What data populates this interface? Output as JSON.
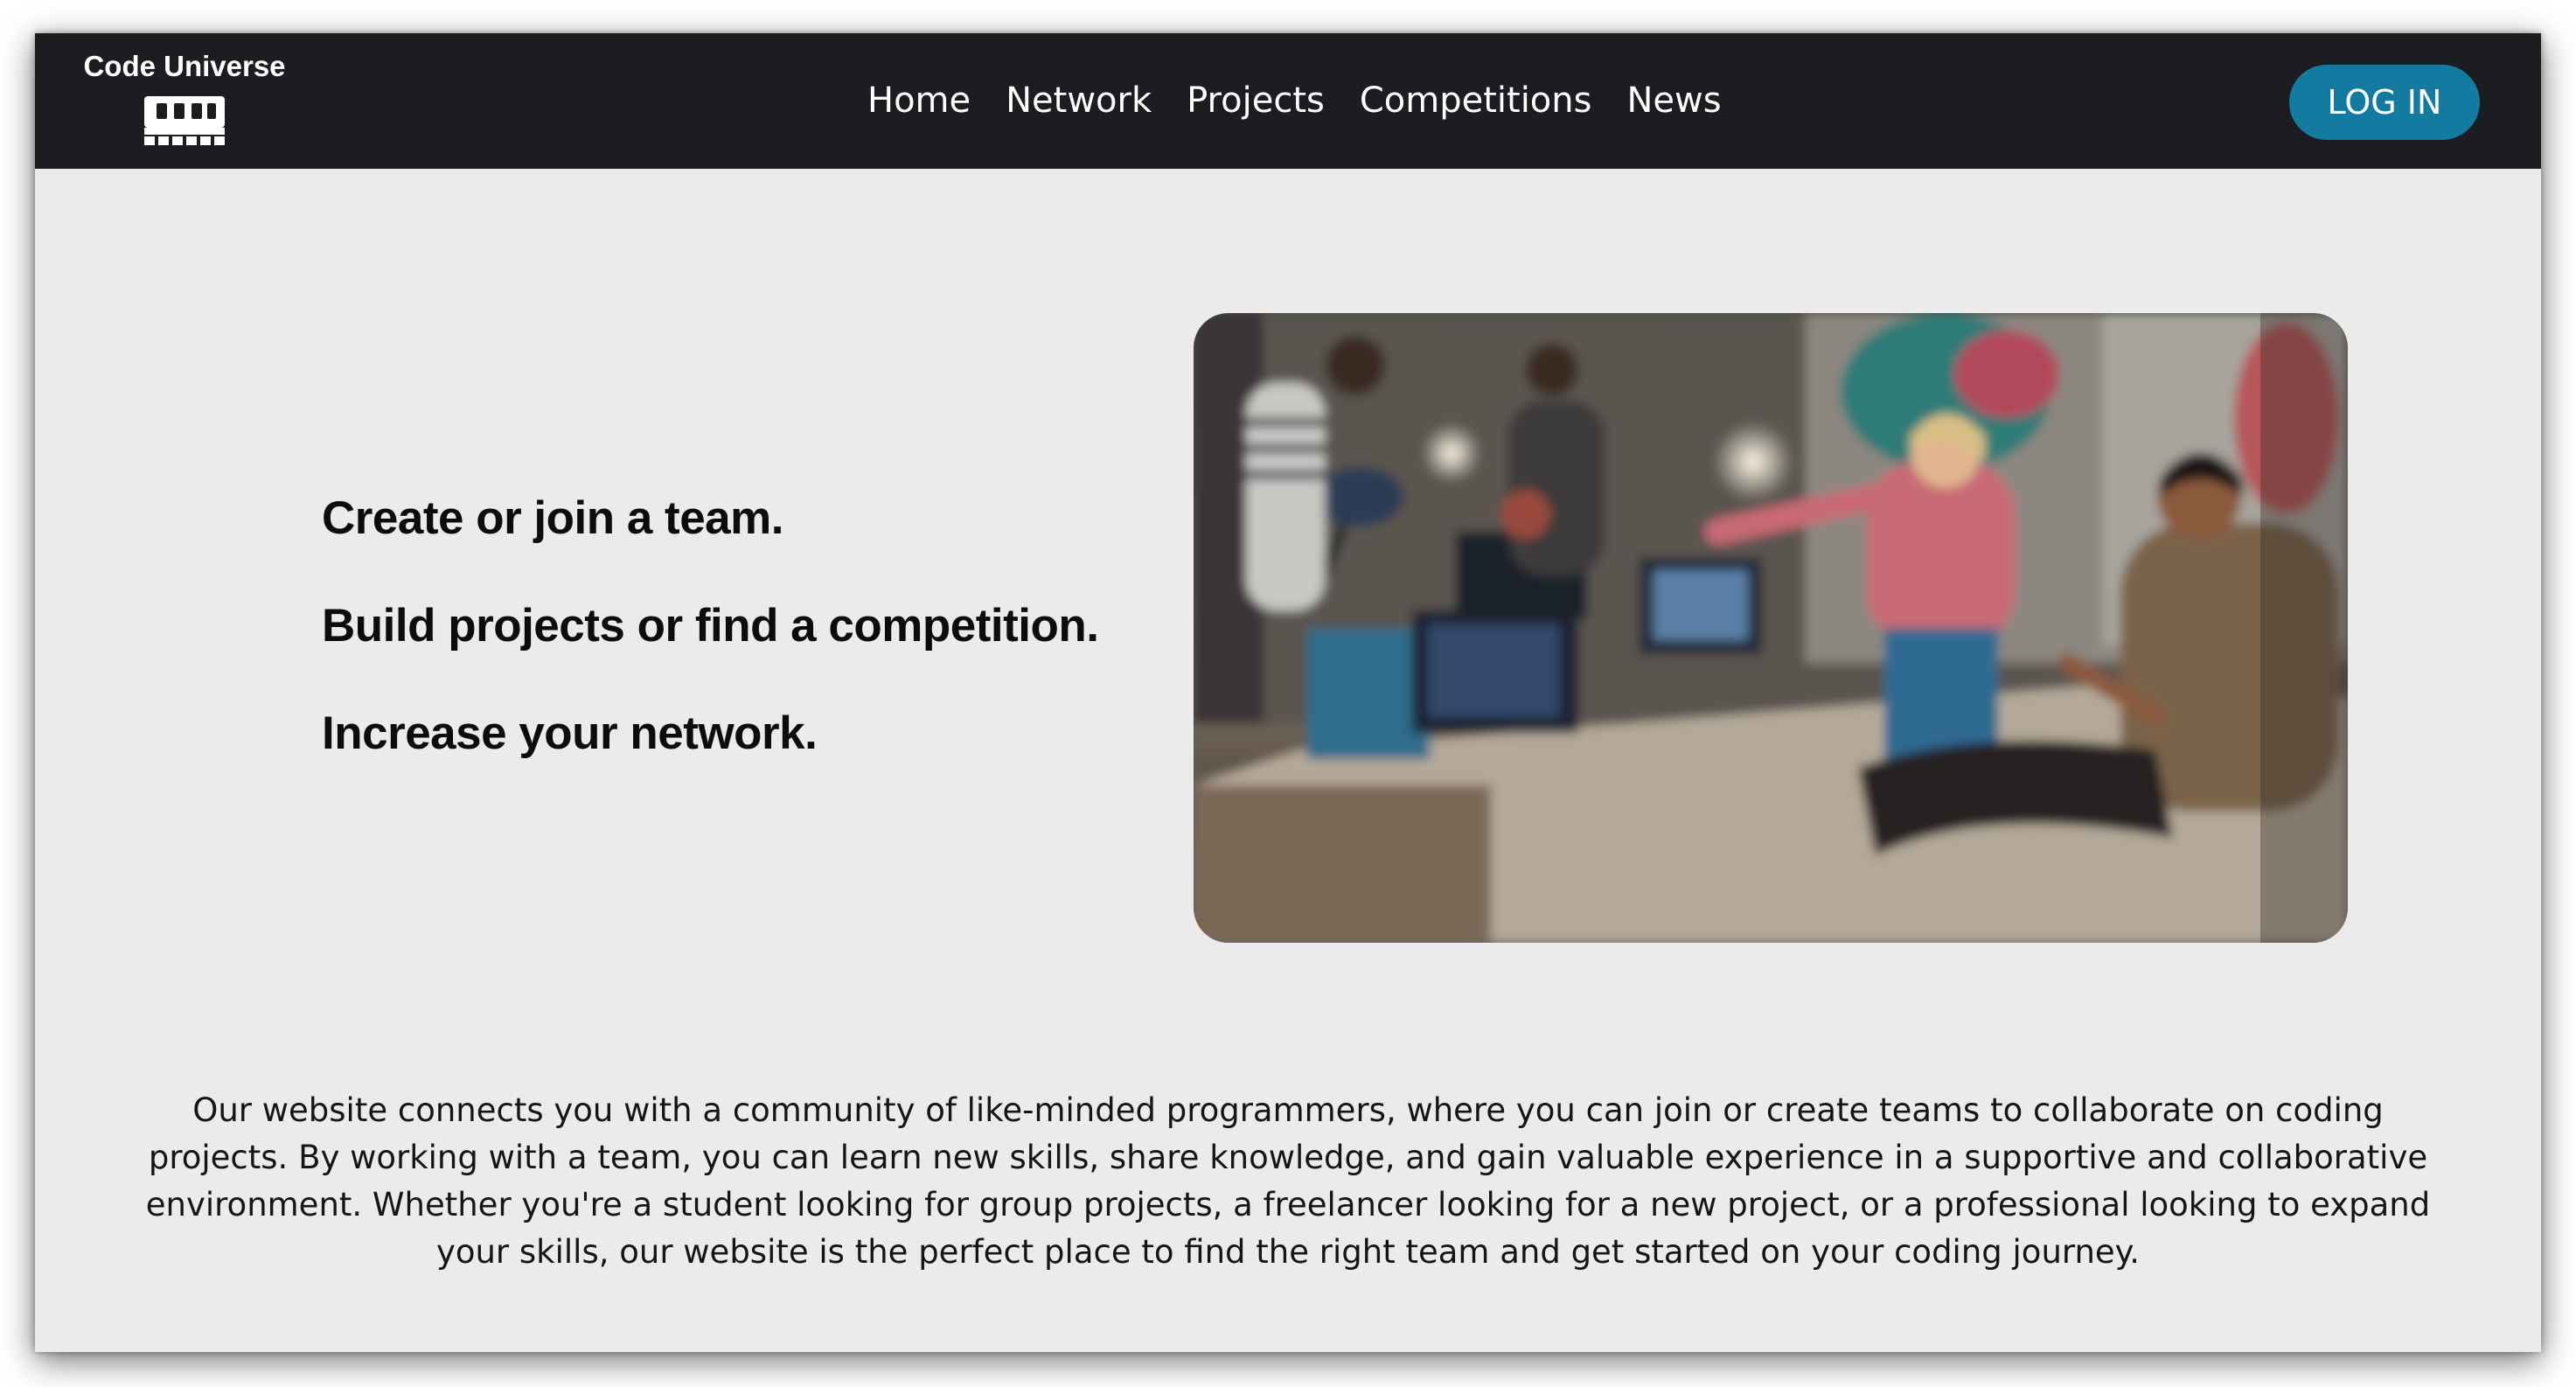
{
  "brand": {
    "name": "Code Universe",
    "icon": "memory-chip-icon"
  },
  "nav": {
    "links": [
      "Home",
      "Network",
      "Projects",
      "Competitions",
      "News"
    ],
    "login_label": "LOG IN"
  },
  "hero": {
    "taglines": [
      "Create or join a team.",
      "Build projects or find a competition.",
      "Increase your network."
    ]
  },
  "description": "Our website connects you with a community of like-minded programmers, where you can join or create teams to collaborate on coding projects. By working with a team, you can learn new skills, share knowledge, and gain valuable experience in a supportive and collaborative environment. Whether you're a student looking for group projects, a freelancer looking for a new project, or a professional looking to expand your skills, our website is the perfect place to find the right team and get started on your coding journey.",
  "colors": {
    "navbar_bg": "#1c1d20",
    "page_bg": "#ebebeb",
    "login_button_bg": "#137aa0",
    "text_dark": "#0c0c0c"
  }
}
